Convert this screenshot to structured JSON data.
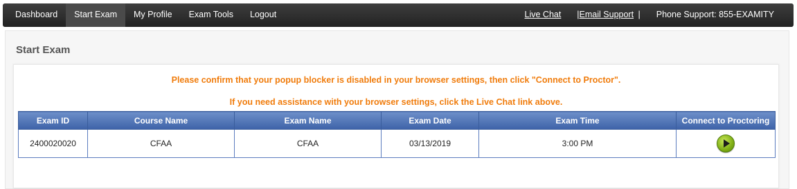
{
  "nav": {
    "items": [
      {
        "label": "Dashboard",
        "active": false
      },
      {
        "label": "Start Exam",
        "active": true
      },
      {
        "label": "My Profile",
        "active": false
      },
      {
        "label": "Exam Tools",
        "active": false
      },
      {
        "label": "Logout",
        "active": false
      }
    ],
    "live_chat": "Live Chat",
    "separator1": "|",
    "email_support": "Email Support",
    "separator2": "|",
    "phone_support": "Phone Support: 855-EXAMITY"
  },
  "page": {
    "title": "Start Exam",
    "message1": "Please confirm that your popup blocker is disabled in your browser settings, then click \"Connect to Proctor\".",
    "message2": "If you need assistance with your browser settings, click the Live Chat link above."
  },
  "table": {
    "headers": [
      "Exam ID",
      "Course Name",
      "Exam Name",
      "Exam Date",
      "Exam Time",
      "Connect to Proctoring"
    ],
    "rows": [
      {
        "exam_id": "2400020020",
        "course_name": "CFAA",
        "exam_name": "CFAA",
        "exam_date": "03/13/2019",
        "exam_time": "3:00 PM",
        "action_icon": "play-icon"
      }
    ]
  },
  "colors": {
    "accent_orange": "#f07c0c",
    "header_blue": "#4a6fb5",
    "navbar": "#2f2f2f",
    "play_green": "#8bbd1a"
  }
}
